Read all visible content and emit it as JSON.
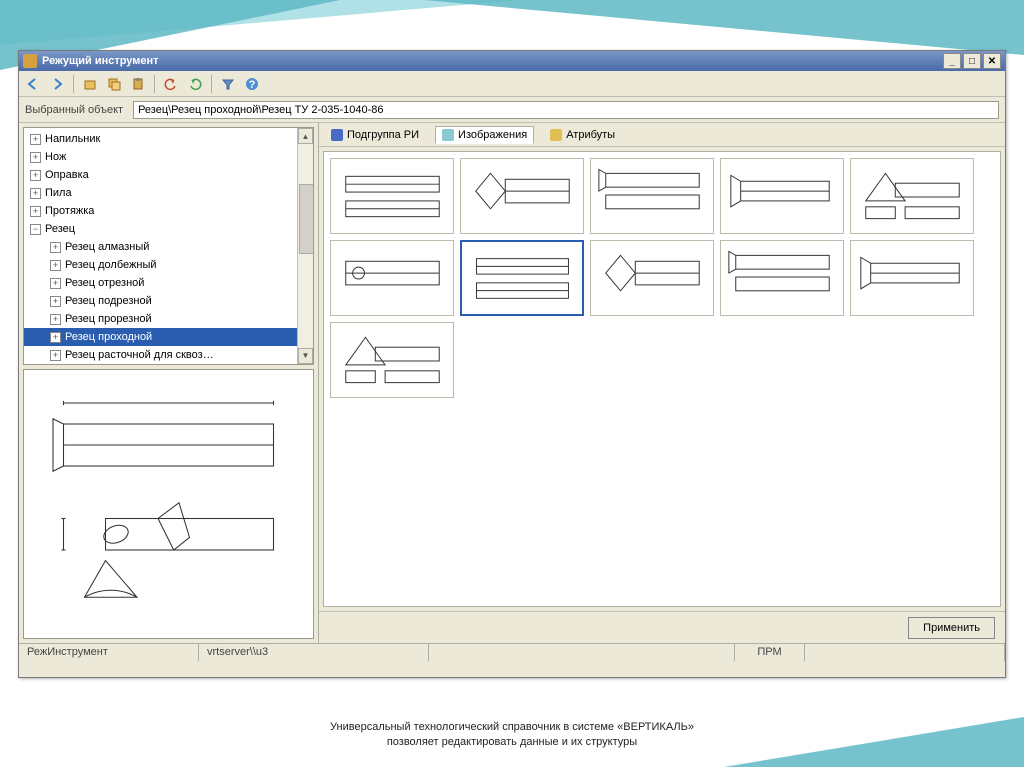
{
  "window": {
    "title": "Режущий инструмент"
  },
  "pathbar": {
    "label": "Выбранный объект",
    "value": "Резец\\Резец проходной\\Резец ТУ 2-035-1040-86"
  },
  "tree": [
    {
      "label": "Напильник",
      "level": 0,
      "expanded": false
    },
    {
      "label": "Нож",
      "level": 0,
      "expanded": false
    },
    {
      "label": "Оправка",
      "level": 0,
      "expanded": false
    },
    {
      "label": "Пила",
      "level": 0,
      "expanded": false
    },
    {
      "label": "Протяжка",
      "level": 0,
      "expanded": false
    },
    {
      "label": "Резец",
      "level": 0,
      "expanded": true
    },
    {
      "label": "Резец алмазный",
      "level": 1,
      "expanded": false
    },
    {
      "label": "Резец долбежный",
      "level": 1,
      "expanded": false
    },
    {
      "label": "Резец отрезной",
      "level": 1,
      "expanded": false
    },
    {
      "label": "Резец подрезной",
      "level": 1,
      "expanded": false
    },
    {
      "label": "Резец прорезной",
      "level": 1,
      "expanded": false
    },
    {
      "label": "Резец проходной",
      "level": 1,
      "expanded": false,
      "selected": true
    },
    {
      "label": "Резец расточной для сквоз…",
      "level": 1,
      "expanded": false
    }
  ],
  "tabs": [
    {
      "label": "Подгруппа РИ",
      "icon": "blue"
    },
    {
      "label": "Изображения",
      "icon": "cyan",
      "active": true
    },
    {
      "label": "Атрибуты",
      "icon": "yel"
    }
  ],
  "thumbnails": {
    "count": 11,
    "selected_index": 6
  },
  "buttons": {
    "apply": "Применить"
  },
  "status": {
    "source": "РежИнструмент",
    "server": "vrtserver\\\\u3",
    "mode": "ПРМ"
  },
  "caption": {
    "line1": "Универсальный технологический справочник в системе «ВЕРТИКАЛЬ»",
    "line2": "позволяет редактировать данные и их структуры"
  }
}
